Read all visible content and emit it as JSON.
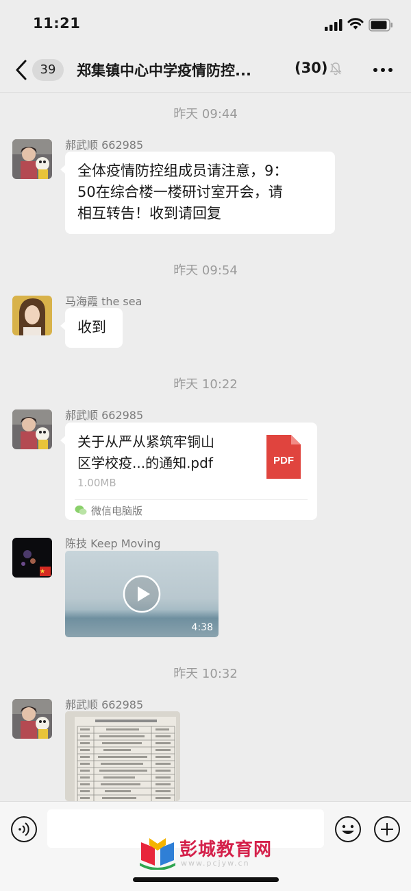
{
  "status_bar": {
    "time": "11:21"
  },
  "header": {
    "unread_count": "39",
    "title": "郑集镇中心中学疫情防控...",
    "member_count": "(30)"
  },
  "messages": [
    {
      "timestamp": "昨天 09:44",
      "sender": "郝武顺 662985",
      "type": "text",
      "lines": [
        "全体疫情防控组成员请注意，9：",
        "50在综合楼一楼研讨室开会，请",
        "相互转告！收到请回复"
      ]
    },
    {
      "timestamp": "昨天 09:54",
      "sender": "马海霞  the  sea",
      "type": "text",
      "lines": [
        "收到"
      ]
    },
    {
      "timestamp": "昨天 10:22",
      "sender": "郝武顺 662985",
      "type": "file",
      "file_name_lines": [
        "关于从严从紧筑牢铜山",
        "区学校疫...的通知.pdf"
      ],
      "file_size": "1.00MB",
      "file_icon_label": "PDF",
      "source": "微信电脑版"
    },
    {
      "sender": "陈技   Keep  Moving",
      "type": "video",
      "duration": "4:38"
    },
    {
      "timestamp": "昨天 10:32",
      "sender": "郝武顺 662985",
      "type": "image"
    }
  ],
  "watermark": {
    "text": "彭城教育网",
    "url": "www.pcjyw.cn"
  },
  "colors": {
    "background": "#ededed",
    "bubble": "#ffffff",
    "pdf": "#e0443e",
    "watermark": "#d4204a"
  }
}
